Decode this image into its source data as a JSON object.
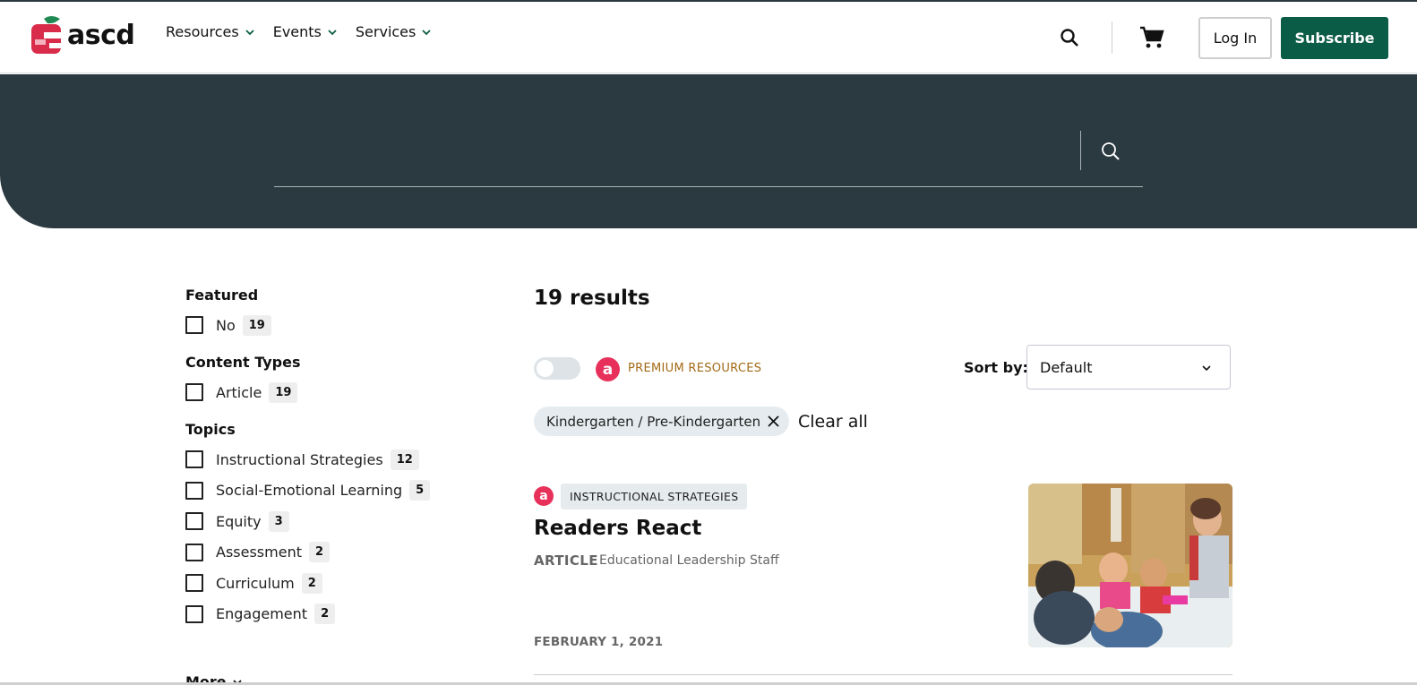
{
  "header": {
    "logo_text": "ascd",
    "nav": [
      {
        "label": "Resources"
      },
      {
        "label": "Events"
      },
      {
        "label": "Services"
      }
    ],
    "login_label": "Log In",
    "subscribe_label": "Subscribe"
  },
  "hero": {
    "search_value": "",
    "search_placeholder": ""
  },
  "filters": {
    "featured": {
      "title": "Featured",
      "items": [
        {
          "label": "No",
          "count": "19"
        }
      ]
    },
    "content_types": {
      "title": "Content Types",
      "items": [
        {
          "label": "Article",
          "count": "19"
        }
      ]
    },
    "topics": {
      "title": "Topics",
      "items": [
        {
          "label": "Instructional Strategies",
          "count": "12"
        },
        {
          "label": "Social-Emotional Learning",
          "count": "5"
        },
        {
          "label": "Equity",
          "count": "3"
        },
        {
          "label": "Assessment",
          "count": "2"
        },
        {
          "label": "Curriculum",
          "count": "2"
        },
        {
          "label": "Engagement",
          "count": "2"
        }
      ],
      "more_label": "More"
    }
  },
  "results": {
    "count_text": "19 results",
    "premium_badge": "a",
    "premium_label": "PREMIUM RESOURCES",
    "sort_label": "Sort by:",
    "sort_value": "Default",
    "active_filter": "Kindergarten / Pre-Kindergarten",
    "clear_all_label": "Clear all",
    "items": [
      {
        "badge": "a",
        "tag": "INSTRUCTIONAL STRATEGIES",
        "title": "Readers React",
        "type": "ARTICLE",
        "author": "Educational Leadership Staff",
        "date": "FEBRUARY 1, 2021"
      }
    ]
  },
  "colors": {
    "brand_green": "#0b5c46",
    "hero_bg": "#2b3a40",
    "premium_red": "#e8315a",
    "premium_gold": "#a36a16"
  },
  "icons": [
    "search-icon",
    "cart-icon",
    "chevron-down-icon",
    "close-icon"
  ]
}
